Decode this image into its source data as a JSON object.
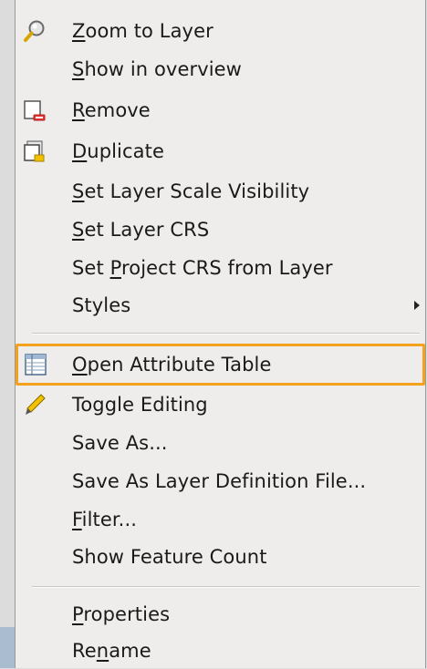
{
  "menu": {
    "items": [
      {
        "name": "menu-item-zoom-to-layer",
        "icon": "zoom-icon",
        "mnemonic": "Z",
        "rest": "oom to Layer",
        "pre": ""
      },
      {
        "name": "menu-item-show-in-overview",
        "icon": "",
        "mnemonic": "S",
        "rest": "how in overview",
        "pre": ""
      },
      {
        "name": "menu-item-remove",
        "icon": "remove-layer-icon",
        "mnemonic": "R",
        "rest": "emove",
        "pre": ""
      },
      {
        "name": "menu-item-duplicate",
        "icon": "duplicate-layer-icon",
        "mnemonic": "D",
        "rest": "uplicate",
        "pre": ""
      },
      {
        "name": "menu-item-set-layer-scale-visibility",
        "icon": "",
        "mnemonic": "S",
        "rest": "et Layer Scale Visibility",
        "pre": ""
      },
      {
        "name": "menu-item-set-layer-crs",
        "icon": "",
        "mnemonic": "S",
        "rest": "et Layer CRS",
        "pre": ""
      },
      {
        "name": "menu-item-set-project-crs",
        "icon": "",
        "mnemonic": "P",
        "rest": "roject CRS from Layer",
        "pre": "Set "
      },
      {
        "name": "menu-item-styles",
        "icon": "",
        "mnemonic": "",
        "rest": "Styles",
        "pre": "",
        "submenu": true
      },
      {
        "name": "menu-item-open-attribute-table",
        "icon": "attribute-table-icon",
        "mnemonic": "O",
        "rest": "pen Attribute Table",
        "pre": "",
        "highlighted": true
      },
      {
        "name": "menu-item-toggle-editing",
        "icon": "pencil-icon",
        "mnemonic": "",
        "rest": "Toggle Editing",
        "pre": ""
      },
      {
        "name": "menu-item-save-as",
        "icon": "",
        "mnemonic": "",
        "rest": "Save As...",
        "pre": ""
      },
      {
        "name": "menu-item-save-as-layer-definition",
        "icon": "",
        "mnemonic": "",
        "rest": "Save As Layer Definition File...",
        "pre": ""
      },
      {
        "name": "menu-item-filter",
        "icon": "",
        "mnemonic": "F",
        "rest": "ilter...",
        "pre": ""
      },
      {
        "name": "menu-item-show-feature-count",
        "icon": "",
        "mnemonic": "",
        "rest": "Show Feature Count",
        "pre": ""
      },
      {
        "name": "menu-item-properties",
        "icon": "",
        "mnemonic": "P",
        "rest": "roperties",
        "pre": ""
      },
      {
        "name": "menu-item-rename",
        "icon": "",
        "mnemonic": "n",
        "rest": "ame",
        "pre": "Re"
      }
    ]
  },
  "colors": {
    "highlight_border": "#f4a21e",
    "menu_background": "#eeedeb"
  }
}
